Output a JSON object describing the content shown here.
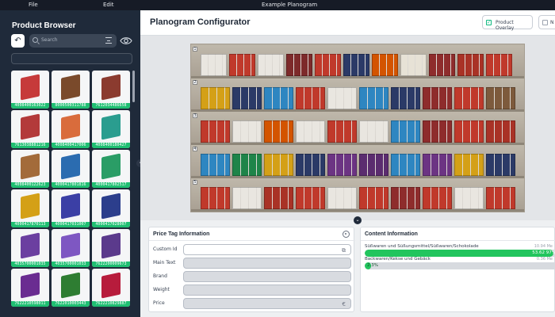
{
  "menu": {
    "file": "File",
    "edit": "Edit",
    "window_title": "Example Planogram"
  },
  "sidebar": {
    "title": "Product Browser",
    "search_placeholder": "Search",
    "products": [
      {
        "code": "4008400163022",
        "color": "#c63a3a"
      },
      {
        "code": "8000500311788",
        "color": "#7a4a2b"
      },
      {
        "code": "7612034486658",
        "color": "#8b3b2f"
      },
      {
        "code": "7613038881216",
        "color": "#b33a3a"
      },
      {
        "code": "4008400417006",
        "color": "#d96c3c"
      },
      {
        "code": "4008400180427",
        "color": "#2a9d8f"
      },
      {
        "code": "4008400122623",
        "color": "#a36b3a"
      },
      {
        "code": "4000417801816",
        "color": "#2b6cb0"
      },
      {
        "code": "4000417802517",
        "color": "#2a9d66"
      },
      {
        "code": "4000417870113",
        "color": "#d4a017"
      },
      {
        "code": "4000417031007",
        "color": "#3b3fa5"
      },
      {
        "code": "4000417028007",
        "color": "#2c3e8c"
      },
      {
        "code": "4035700001035",
        "color": "#6b3fa0"
      },
      {
        "code": "4035700001033",
        "color": "#7e57c2"
      },
      {
        "code": "7622200009673",
        "color": "#5b3a8c"
      },
      {
        "code": "7622210598011",
        "color": "#6a2c91"
      },
      {
        "code": "7622010003443",
        "color": "#2e7d32"
      },
      {
        "code": "7622210829887",
        "color": "#b71c3c"
      }
    ]
  },
  "header": {
    "title": "Planogram Configurator",
    "overlay_label": "Product Overlay",
    "n_label": "N"
  },
  "shelves": [
    {
      "number": "1",
      "items": [
        "#e9e6e0",
        "#c0392b",
        "#e9e6e0",
        "#7d2a2a",
        "#c0392b",
        "#2b3a67",
        "#d35400",
        "#e7e2d6",
        "#8e2c2c",
        "#a93226",
        "#c0392b"
      ]
    },
    {
      "number": "2",
      "items": [
        "#d4a017",
        "#2b3a67",
        "#2e86c1",
        "#c0392b",
        "#e9e6e0",
        "#2e86c1",
        "#2b3a67",
        "#8e2c2c",
        "#c0392b",
        "#7d5a3c"
      ]
    },
    {
      "number": "3",
      "items": [
        "#c0392b",
        "#e9e6e0",
        "#d35400",
        "#e9e6e0",
        "#c0392b",
        "#e9e6e0",
        "#2e86c1",
        "#8e2c2c",
        "#c0392b",
        "#a93226"
      ]
    },
    {
      "number": "4",
      "items": [
        "#2e86c1",
        "#1e8449",
        "#d4a017",
        "#2b3a67",
        "#6c3483",
        "#5b2c6f",
        "#2e86c1",
        "#6c3483",
        "#d4a017",
        "#2b3a67"
      ]
    },
    {
      "number": "5",
      "items": [
        "#c0392b",
        "#e9e6e0",
        "#a93226",
        "#c0392b",
        "#e9e6e0",
        "#c0392b",
        "#8e2c2c",
        "#c0392b",
        "#e9e6e0",
        "#c0392b"
      ]
    }
  ],
  "price_tag": {
    "title": "Price Tag Information",
    "fields": [
      {
        "label": "Custom Id",
        "value": ""
      },
      {
        "label": "Main Text",
        "value": ""
      },
      {
        "label": "Brand",
        "value": ""
      },
      {
        "label": "Weight",
        "value": ""
      },
      {
        "label": "Price",
        "value": ""
      }
    ]
  },
  "content": {
    "title": "Content Information",
    "rows": [
      {
        "label": "Süßwaren und Süßungsmittel/Süßwaren/Schokolade",
        "value": "10.94 Me",
        "pct_label": "53.62 97%",
        "pct": 0.97
      },
      {
        "label": "Backwaren/Kekse und Gebäck",
        "value": "0.36 Me",
        "pct_label": "2.3%",
        "pct": 0.03
      }
    ]
  }
}
